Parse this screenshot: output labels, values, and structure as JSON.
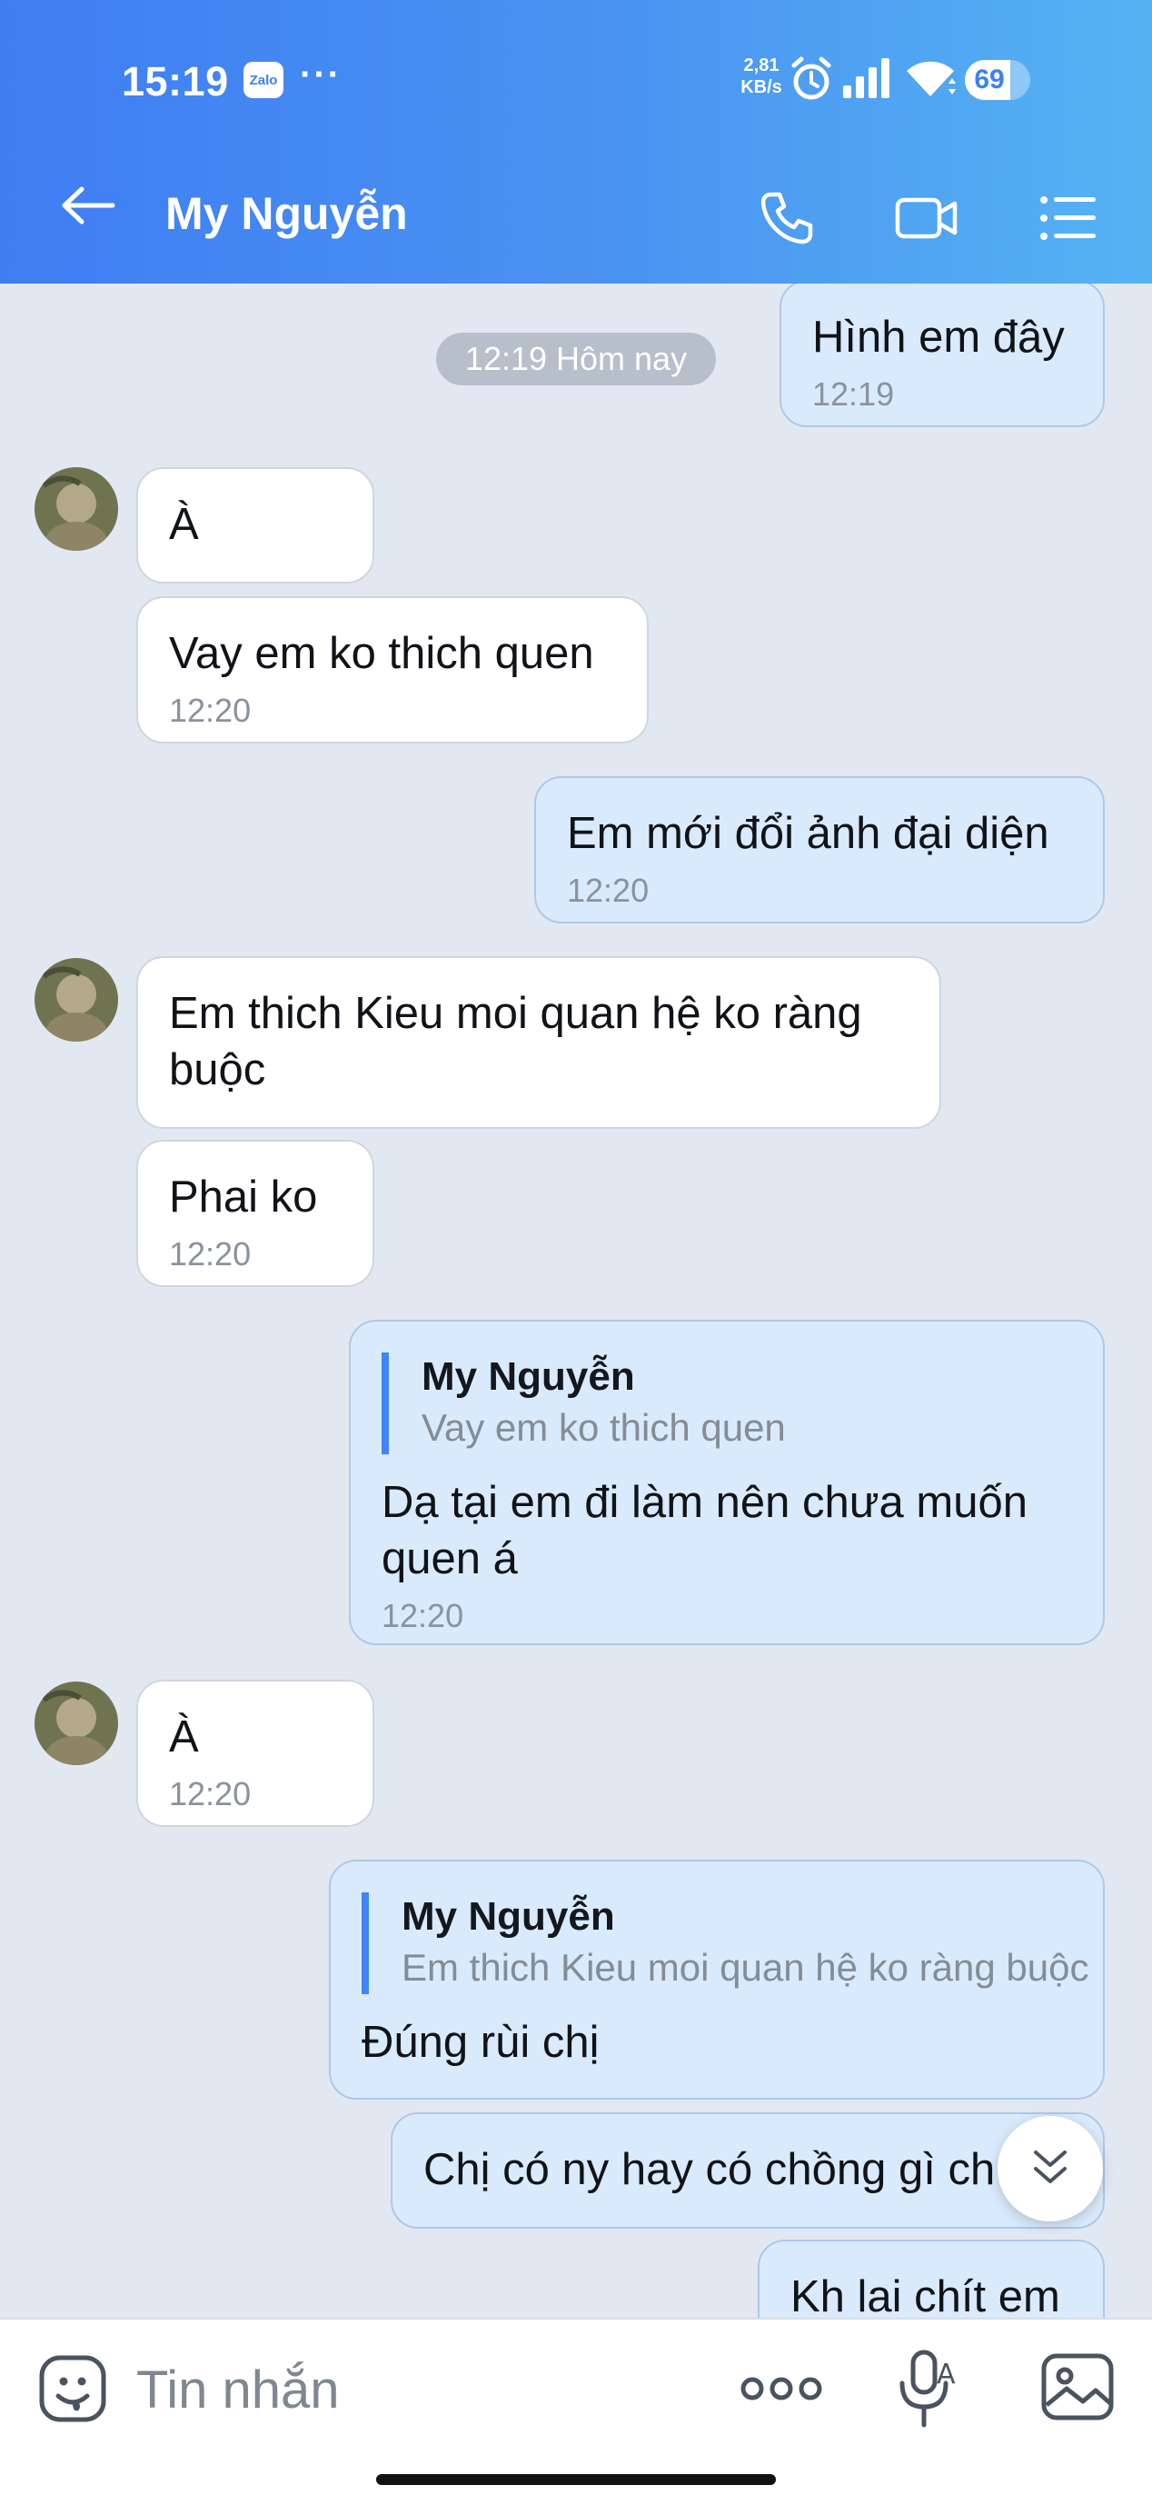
{
  "status_bar": {
    "time": "15:19",
    "zalo_badge": "Zalo",
    "more_dots": "···",
    "net_speed_value": "2,81",
    "net_speed_unit": "KB/s",
    "battery": "69",
    "battery_level": 0.69,
    "icons": [
      "zalo-icon",
      "alarm-icon",
      "signal-icon",
      "wifi-icon",
      "battery-icon"
    ]
  },
  "header": {
    "contact_name": "My Nguyễn",
    "icons": [
      "back-arrow-icon",
      "phone-icon",
      "video-call-icon",
      "list-menu-icon"
    ]
  },
  "chat": {
    "date_separator": "12:19 Hôm nay",
    "messages": [
      {
        "id": "m1",
        "direction": "out",
        "text": "Hình em đây",
        "time": "12:19"
      },
      {
        "id": "m2",
        "direction": "in",
        "text": "À",
        "time": ""
      },
      {
        "id": "m3",
        "direction": "in",
        "text": "Vay em ko thich quen",
        "time": "12:20"
      },
      {
        "id": "m4",
        "direction": "out",
        "text": "Em mới đổi ảnh đại diện",
        "time": "12:20"
      },
      {
        "id": "m5",
        "direction": "in",
        "text": "Em thich Kieu moi quan hệ ko ràng\nbuộc",
        "time": ""
      },
      {
        "id": "m6",
        "direction": "in",
        "text": "Phai ko",
        "time": "12:20"
      },
      {
        "id": "m7",
        "direction": "out",
        "quote_name": "My Nguyễn",
        "quote_text": "Vay em ko thich quen",
        "text": "Dạ tại em đi làm nên chưa muốn\nquen á",
        "time": "12:20"
      },
      {
        "id": "m8",
        "direction": "in",
        "text": "À",
        "time": "12:20"
      },
      {
        "id": "m9",
        "direction": "out",
        "quote_name": "My Nguyễn",
        "quote_text": "Em thich Kieu moi quan hệ ko ràng buộc",
        "text": "Đúng rùi chị",
        "time": ""
      },
      {
        "id": "m10",
        "direction": "out",
        "text": "Chị có ny hay có chồng gì ch",
        "time": ""
      },
      {
        "id": "m11",
        "direction": "out",
        "text": "Kh lai chít em",
        "time": ""
      }
    ]
  },
  "input_bar": {
    "placeholder": "Tin nhắn",
    "icons": [
      "sticker-icon",
      "more-options-icon",
      "voice-to-text-icon",
      "image-icon"
    ]
  },
  "colors": {
    "header_gradient_start": "#3f7df3",
    "header_gradient_end": "#56b3f3",
    "chat_background": "#e2e8f1",
    "incoming_bubble": "#ffffff",
    "outgoing_bubble": "#d9eafc",
    "quote_bar": "#3d86f3"
  }
}
